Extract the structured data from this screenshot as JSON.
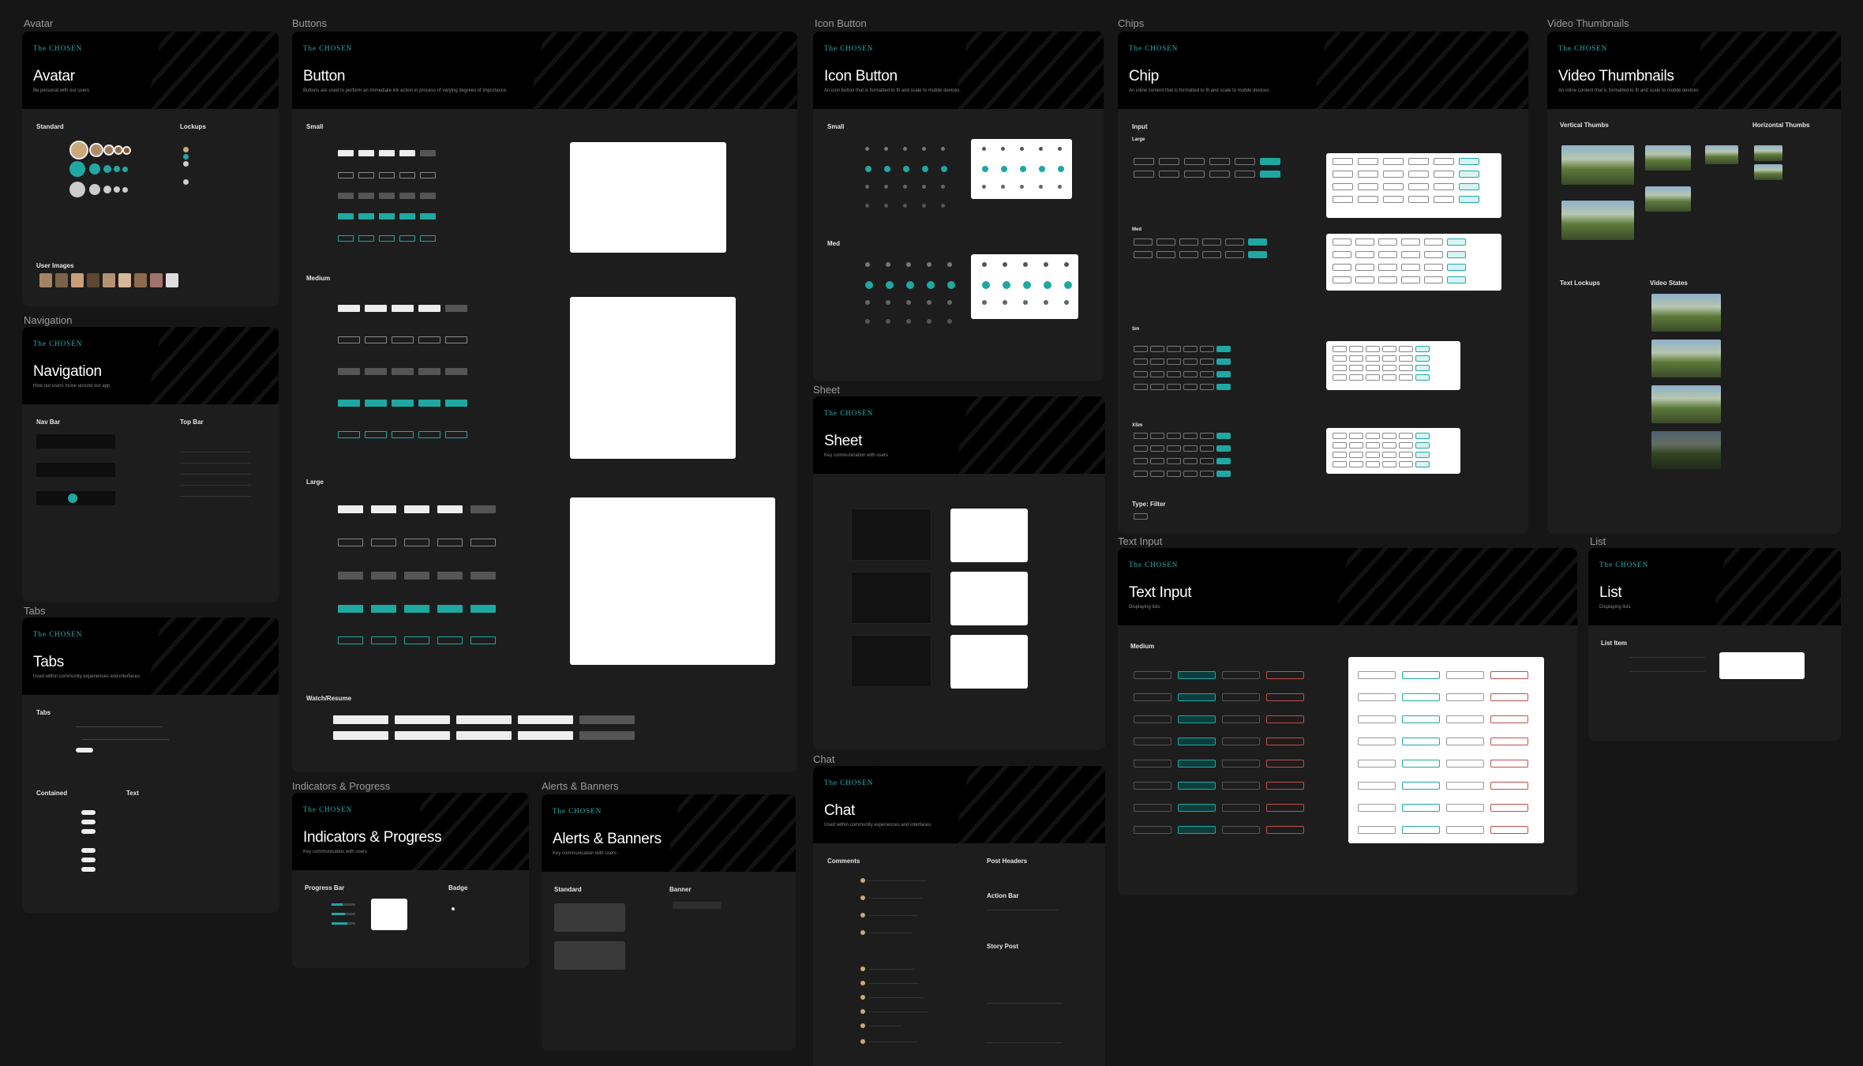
{
  "frames": {
    "avatar": {
      "label": "Avatar",
      "title": "Avatar",
      "subtitle": "Be personal with our users",
      "standard": "Standard",
      "lockups": "Lockups",
      "user_images": "User Images"
    },
    "navigation": {
      "label": "Navigation",
      "title": "Navigation",
      "subtitle": "How our users move around our app",
      "nav_bar": "Nav Bar",
      "top_bar": "Top Bar"
    },
    "tabs": {
      "label": "Tabs",
      "title": "Tabs",
      "subtitle": "Used within community experiences and interfaces",
      "tabs": "Tabs",
      "contained": "Contained",
      "text": "Text"
    },
    "buttons": {
      "label": "Buttons",
      "title": "Button",
      "subtitle": "Buttons are used to perform an immediate ink action in process of varying degrees of importance.",
      "small": "Small",
      "medium": "Medium",
      "large": "Large",
      "watch": "Watch/Resume"
    },
    "indicators": {
      "label": "Indicators & Progress",
      "title": "Indicators & Progress",
      "subtitle": "Key communication with users",
      "progress": "Progress Bar",
      "badge": "Badge"
    },
    "alerts": {
      "label": "Alerts & Banners",
      "title": "Alerts & Banners",
      "subtitle": "Key communication with users",
      "standard": "Standard",
      "banner": "Banner"
    },
    "icon_button": {
      "label": "Icon Button",
      "title": "Icon Button",
      "subtitle": "An icon button that is formatted to fit and scale to mobile devices.",
      "small": "Small",
      "med": "Med"
    },
    "sheet": {
      "label": "Sheet",
      "title": "Sheet",
      "subtitle": "Key communication with users"
    },
    "chat": {
      "label": "Chat",
      "title": "Chat",
      "subtitle": "Used within community experiences and interfaces",
      "comments": "Comments",
      "post_headers": "Post Headers",
      "action_bar": "Action Bar",
      "story_post": "Story Post"
    },
    "chips": {
      "label": "Chips",
      "title": "Chip",
      "subtitle": "An inline content that is formatted to fit and scale to mobile devices.",
      "input": "Input",
      "large": "Large",
      "med": "Med",
      "sm": "Sm",
      "xsm": "XSm",
      "filter": "Type: Filter"
    },
    "video": {
      "label": "Video Thumbnails",
      "title": "Video Thumbnails",
      "subtitle": "An inline content that is formatted to fit and scale to mobile devices.",
      "vertical": "Vertical Thumbs",
      "horizontal": "Horizontal Thumbs",
      "lockups": "Text Lockups",
      "states": "Video States"
    },
    "text_input": {
      "label": "Text Input",
      "title": "Text Input",
      "subtitle": "Displaying lists",
      "medium": "Medium"
    },
    "list": {
      "label": "List",
      "title": "List",
      "subtitle": "Displaying lists",
      "list_item": "List Item"
    }
  },
  "brand": {
    "logo": "The CHOSEN",
    "accent": "#1fa8a2",
    "background": "#161616"
  }
}
